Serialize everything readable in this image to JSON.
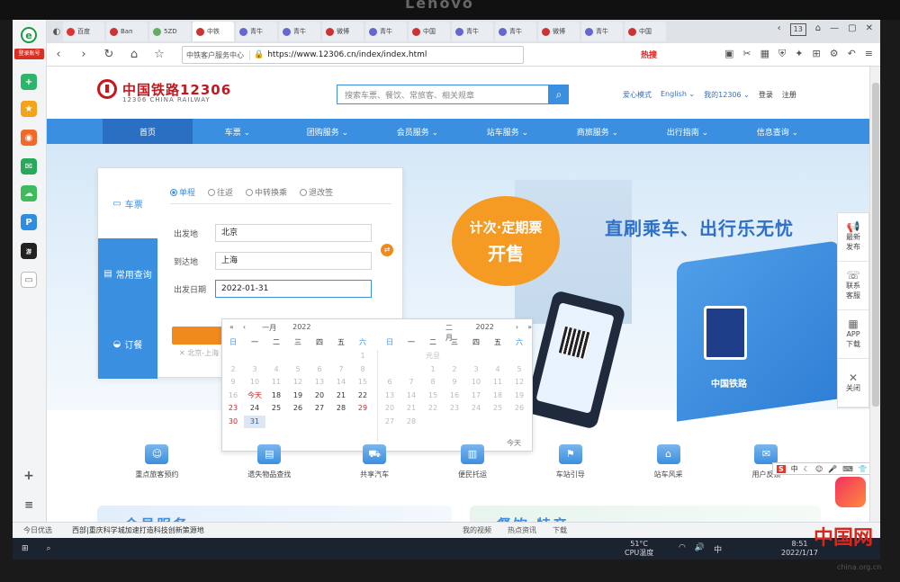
{
  "bezel_brand": "Lenovo",
  "rail": {
    "badge": "登录账号"
  },
  "tabs": [
    {
      "label": "百度",
      "color": "#d33"
    },
    {
      "label": "Ban",
      "color": "#c33"
    },
    {
      "label": "5ZD",
      "color": "#6a6"
    },
    {
      "label": "中铁",
      "color": "#c33",
      "active": true
    },
    {
      "label": "青牛",
      "color": "#66c"
    },
    {
      "label": "青牛",
      "color": "#66c"
    },
    {
      "label": "微博",
      "color": "#c33"
    },
    {
      "label": "青牛",
      "color": "#66c"
    },
    {
      "label": "中国",
      "color": "#c33"
    },
    {
      "label": "青牛",
      "color": "#66c"
    },
    {
      "label": "青牛",
      "color": "#66c"
    },
    {
      "label": "微博",
      "color": "#c33"
    },
    {
      "label": "青牛",
      "color": "#66c"
    },
    {
      "label": "中国",
      "color": "#c33"
    }
  ],
  "tab_count": "13",
  "toolbar": {
    "site_name": "中铁客户服务中心",
    "url": "https://www.12306.cn/index/index.html",
    "hot_label": "热搜"
  },
  "header": {
    "logo_cn": "中国铁路12306",
    "logo_en": "12306 CHINA RAILWAY",
    "search_placeholder": "搜索车票、餐饮、常旅客、相关规章",
    "links": [
      "爱心模式",
      "English ⌄",
      "我的12306 ⌄"
    ],
    "login": "登录",
    "register": "注册"
  },
  "nav": [
    {
      "label": "首页",
      "active": true
    },
    {
      "label": "车票 ⌄"
    },
    {
      "label": "团购服务 ⌄"
    },
    {
      "label": "会员服务 ⌄"
    },
    {
      "label": "站车服务 ⌄"
    },
    {
      "label": "商旅服务 ⌄"
    },
    {
      "label": "出行指南 ⌄"
    },
    {
      "label": "信息查询 ⌄"
    }
  ],
  "banner": {
    "bubble_line1": "计次·定期票",
    "bubble_line2": "开售",
    "slogan": "直刷乘车、出行乐无忧",
    "kiosk_logo": "中国铁路"
  },
  "booking": {
    "side": [
      {
        "label": "车票",
        "icon": "train-icon",
        "active": true
      },
      {
        "label": "常用查询",
        "icon": "list-icon"
      },
      {
        "label": "订餐",
        "icon": "dish-icon"
      }
    ],
    "trip_types": [
      {
        "label": "单程",
        "on": true
      },
      {
        "label": "往返"
      },
      {
        "label": "中转换乘"
      },
      {
        "label": "退改签"
      }
    ],
    "from_label": "出发地",
    "from_value": "北京",
    "to_label": "到达地",
    "to_value": "上海",
    "date_label": "出发日期",
    "date_value": "2022-01-31",
    "history": "北京-上海"
  },
  "calendar": {
    "left": {
      "month": "一月",
      "year": "2022"
    },
    "right": {
      "month": "二月",
      "year": "2022"
    },
    "weekdays": [
      "日",
      "一",
      "二",
      "三",
      "四",
      "五",
      "六"
    ],
    "left_rows": [
      [
        {
          "d": ""
        },
        {
          "d": ""
        },
        {
          "d": ""
        },
        {
          "d": ""
        },
        {
          "d": ""
        },
        {
          "d": ""
        },
        {
          "d": "1",
          "c": "past"
        }
      ],
      [
        {
          "d": "2",
          "c": "past"
        },
        {
          "d": "3",
          "c": "past"
        },
        {
          "d": "4",
          "c": "past"
        },
        {
          "d": "5",
          "c": "past"
        },
        {
          "d": "6",
          "c": "past"
        },
        {
          "d": "7",
          "c": "past"
        },
        {
          "d": "8",
          "c": "past"
        }
      ],
      [
        {
          "d": "9",
          "c": "past"
        },
        {
          "d": "10",
          "c": "past"
        },
        {
          "d": "11",
          "c": "past"
        },
        {
          "d": "12",
          "c": "past"
        },
        {
          "d": "13",
          "c": "past"
        },
        {
          "d": "14",
          "c": "past"
        },
        {
          "d": "15",
          "c": "past"
        }
      ],
      [
        {
          "d": "16",
          "c": "past"
        },
        {
          "d": "今天",
          "c": "red"
        },
        {
          "d": "18"
        },
        {
          "d": "19"
        },
        {
          "d": "20"
        },
        {
          "d": "21"
        },
        {
          "d": "22"
        }
      ],
      [
        {
          "d": "23",
          "c": "red"
        },
        {
          "d": "24"
        },
        {
          "d": "25"
        },
        {
          "d": "26"
        },
        {
          "d": "27"
        },
        {
          "d": "28"
        },
        {
          "d": "29",
          "c": "red"
        }
      ],
      [
        {
          "d": "30",
          "c": "red"
        },
        {
          "d": "31",
          "c": "sel"
        },
        {
          "d": ""
        },
        {
          "d": ""
        },
        {
          "d": ""
        },
        {
          "d": ""
        },
        {
          "d": ""
        }
      ]
    ],
    "right_rows": [
      [
        {
          "d": ""
        },
        {
          "d": ""
        },
        {
          "d": "元旦",
          "c": "past"
        },
        {
          "d": ""
        },
        {
          "d": ""
        },
        {
          "d": ""
        },
        {
          "d": ""
        }
      ],
      [
        {
          "d": ""
        },
        {
          "d": ""
        },
        {
          "d": "1",
          "c": "past"
        },
        {
          "d": "2",
          "c": "past"
        },
        {
          "d": "3",
          "c": "past"
        },
        {
          "d": "4",
          "c": "past"
        },
        {
          "d": "5",
          "c": "past"
        }
      ],
      [
        {
          "d": "6",
          "c": "past"
        },
        {
          "d": "7",
          "c": "past"
        },
        {
          "d": "8",
          "c": "past"
        },
        {
          "d": "9",
          "c": "past"
        },
        {
          "d": "10",
          "c": "past"
        },
        {
          "d": "11",
          "c": "past"
        },
        {
          "d": "12",
          "c": "past"
        }
      ],
      [
        {
          "d": "13",
          "c": "past"
        },
        {
          "d": "14",
          "c": "past"
        },
        {
          "d": "15",
          "c": "past"
        },
        {
          "d": "16",
          "c": "past"
        },
        {
          "d": "17",
          "c": "past"
        },
        {
          "d": "18",
          "c": "past"
        },
        {
          "d": "19",
          "c": "past"
        }
      ],
      [
        {
          "d": "20",
          "c": "past"
        },
        {
          "d": "21",
          "c": "past"
        },
        {
          "d": "22",
          "c": "past"
        },
        {
          "d": "23",
          "c": "past"
        },
        {
          "d": "24",
          "c": "past"
        },
        {
          "d": "25",
          "c": "past"
        },
        {
          "d": "26",
          "c": "past"
        }
      ],
      [
        {
          "d": "27",
          "c": "past"
        },
        {
          "d": "28",
          "c": "past"
        },
        {
          "d": ""
        },
        {
          "d": ""
        },
        {
          "d": ""
        },
        {
          "d": ""
        },
        {
          "d": ""
        }
      ]
    ],
    "today_label": "今天"
  },
  "float_panel": [
    {
      "label": "最新\n发布",
      "icon": "megaphone-icon"
    },
    {
      "label": "联系\n客服",
      "icon": "phone-icon"
    },
    {
      "label": "APP\n下载",
      "icon": "qr-icon"
    },
    {
      "label": "关闭",
      "icon": "close-icon"
    }
  ],
  "services": [
    {
      "label": "重点旅客预约",
      "icon": "person-icon"
    },
    {
      "label": "遗失物品查找",
      "icon": "box-icon"
    },
    {
      "label": "共享汽车",
      "icon": "car-icon"
    },
    {
      "label": "便民托运",
      "icon": "luggage-icon"
    },
    {
      "label": "车站引导",
      "icon": "signpost-icon"
    },
    {
      "label": "站车风采",
      "icon": "building-icon"
    },
    {
      "label": "用户反馈",
      "icon": "chat-icon"
    }
  ],
  "sections": {
    "member": "会员服务",
    "food": "餐饮·特产"
  },
  "ime": {
    "brand": "S",
    "mode": "中"
  },
  "status": {
    "today": "今日优选",
    "news": "西部|重庆科学城加速打造科技创新策源地",
    "items": [
      "我的视频",
      "热点资讯",
      "下载"
    ]
  },
  "taskbar": {
    "temp": "51°C",
    "temp_label": "CPU温度",
    "ime": "中",
    "time": "8:51",
    "date": "2022/1/17"
  },
  "watermark": {
    "main": "中国网",
    "sub": "china.org.cn"
  }
}
